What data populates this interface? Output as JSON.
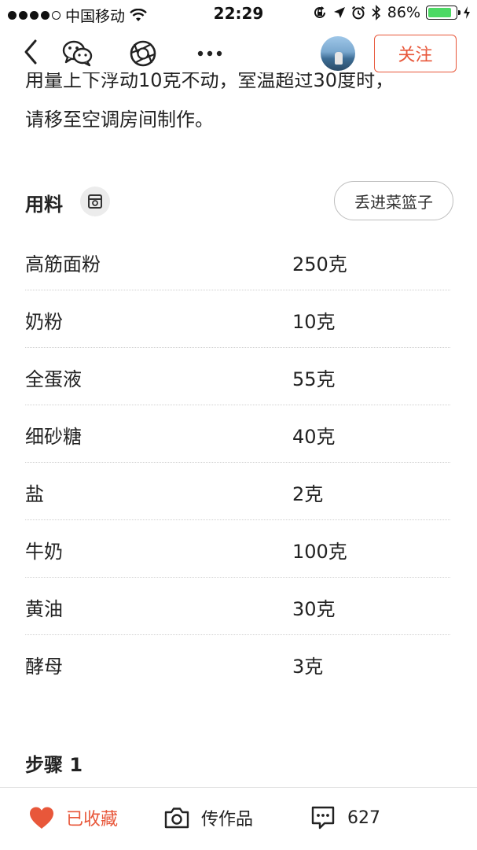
{
  "status_bar": {
    "carrier": "中国移动",
    "time": "22:29",
    "battery_percent": "86%",
    "battery_level": 0.86,
    "signal_dots_filled": 4,
    "signal_dots_total": 5
  },
  "nav": {
    "follow_label": "关注",
    "accent_color": "#e8573a"
  },
  "intro": {
    "line1_partial": "用量上下浮动10克不动，室温超过30度时，",
    "line2": "请移至空调房间制作。"
  },
  "ingredients": {
    "title": "用料",
    "basket_button": "丢进菜篮子",
    "items": [
      {
        "name": "高筋面粉",
        "amount": "250克"
      },
      {
        "name": "奶粉",
        "amount": "10克"
      },
      {
        "name": "全蛋液",
        "amount": "55克"
      },
      {
        "name": "细砂糖",
        "amount": "40克"
      },
      {
        "name": "盐",
        "amount": "2克"
      },
      {
        "name": "牛奶",
        "amount": "100克"
      },
      {
        "name": "黄油",
        "amount": "30克"
      },
      {
        "name": "酵母",
        "amount": "3克"
      }
    ]
  },
  "step": {
    "title": "步骤 1"
  },
  "bottom_bar": {
    "favorited_label": "已收藏",
    "upload_label": "传作品",
    "comment_count": "627"
  },
  "icons": {
    "back": "back-arrow-icon",
    "wechat": "wechat-icon",
    "moments": "moments-icon",
    "more": "more-icon",
    "scale": "scale-icon",
    "heart": "heart-icon",
    "camera": "camera-icon",
    "comment": "comment-icon"
  }
}
